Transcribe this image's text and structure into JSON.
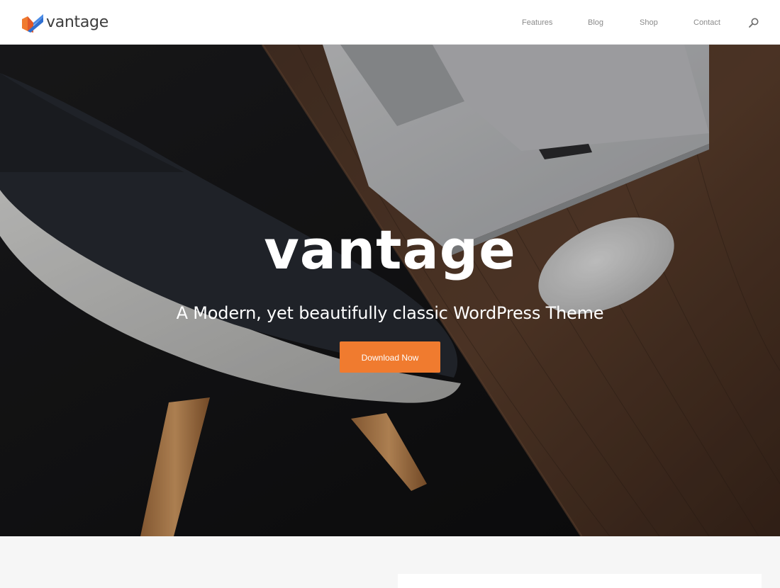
{
  "header": {
    "logo_text": "vantage",
    "nav": [
      {
        "label": "Features"
      },
      {
        "label": "Blog"
      },
      {
        "label": "Shop"
      },
      {
        "label": "Contact"
      }
    ],
    "search_icon": "search-icon"
  },
  "hero": {
    "title": "vantage",
    "subtitle": "A Modern, yet beautifully classic WordPress Theme",
    "button_label": "Download Now"
  },
  "colors": {
    "accent": "#f07b2f",
    "logo_blue": "#2f6fd1",
    "logo_orange": "#f07b2f",
    "nav_text": "#8a8a8a"
  }
}
